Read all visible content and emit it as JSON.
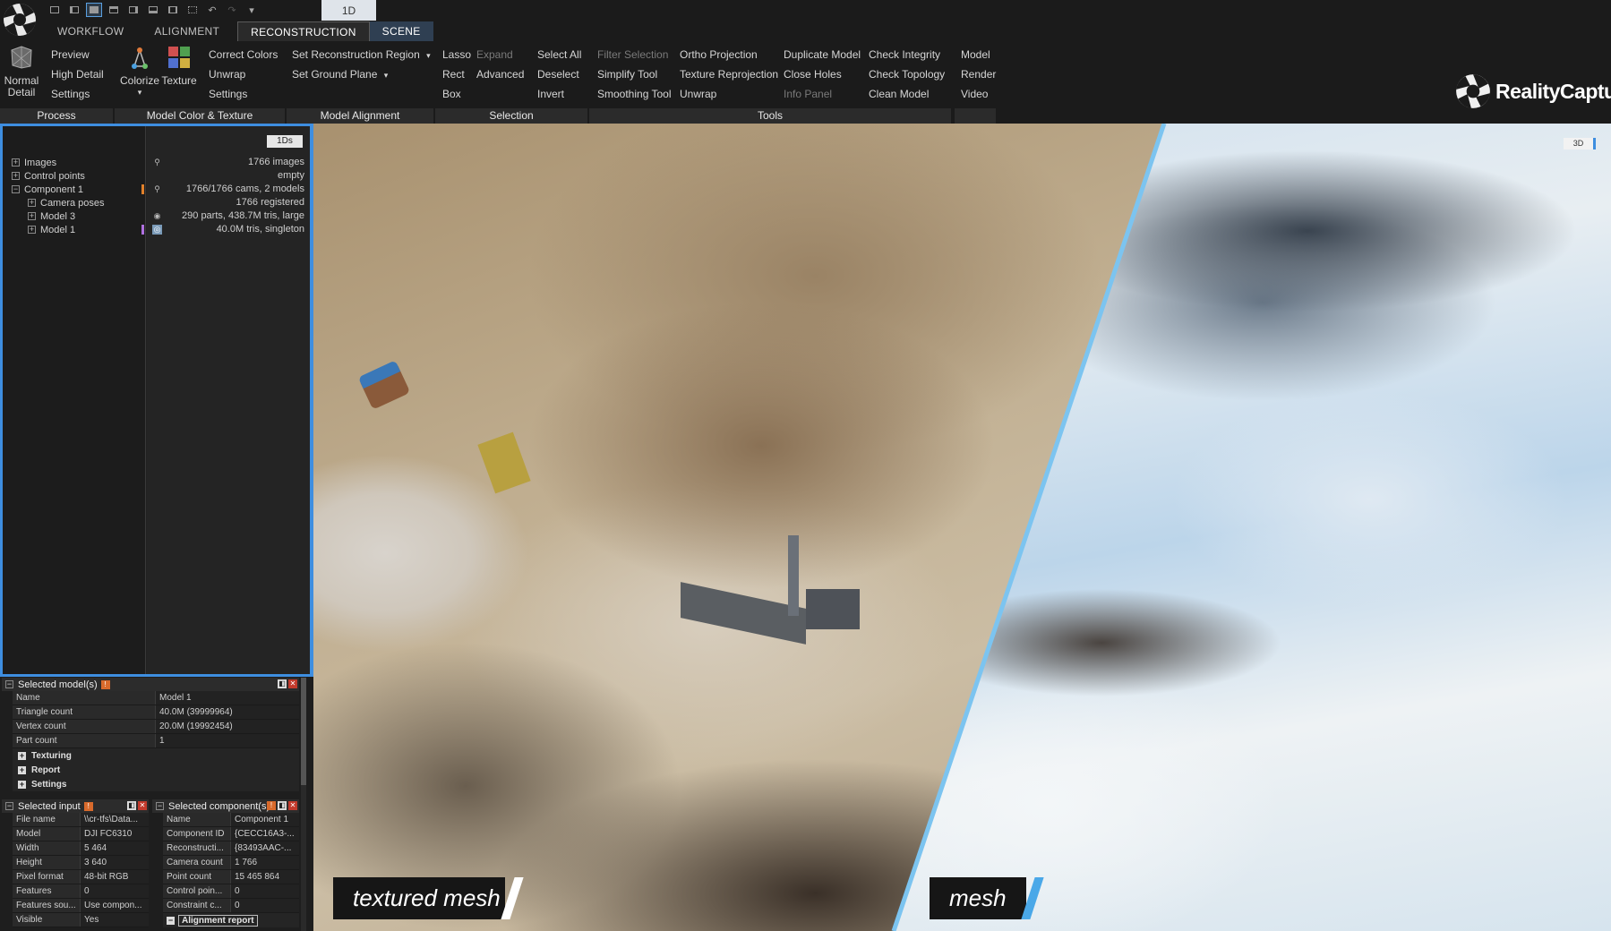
{
  "quick_toolbar": [
    "layout-1-icon",
    "layout-2-icon",
    "layout-3-icon",
    "layout-4-icon",
    "layout-5-icon",
    "layout-6-icon",
    "layout-7-icon",
    "layout-8-icon",
    "undo-icon",
    "redo-icon",
    "customize-icon"
  ],
  "tabs": [
    {
      "label": "WORKFLOW"
    },
    {
      "label": "ALIGNMENT"
    },
    {
      "label": "RECONSTRUCTION"
    },
    {
      "label": "SCENE"
    }
  ],
  "tab_1d": "1D",
  "ribbon": {
    "process": {
      "label": "Process",
      "normal_detail": "Normal\nDetail",
      "preview": "Preview",
      "high_detail": "High Detail",
      "settings": "Settings"
    },
    "model_color": {
      "label": "Model Color & Texture",
      "colorize": "Colorize",
      "texture": "Texture",
      "correct_colors": "Correct Colors",
      "unwrap": "Unwrap",
      "settings": "Settings"
    },
    "alignment": {
      "label": "Model Alignment",
      "set_region": "Set Reconstruction Region",
      "set_ground": "Set Ground Plane"
    },
    "selection": {
      "label": "Selection",
      "lasso": "Lasso",
      "expand": "Expand",
      "rect": "Rect",
      "advanced": "Advanced",
      "box": "Box",
      "select_all": "Select All",
      "deselect": "Deselect",
      "invert": "Invert"
    },
    "tools": {
      "label": "Tools",
      "filter_selection": "Filter Selection",
      "simplify_tool": "Simplify Tool",
      "smoothing_tool": "Smoothing Tool",
      "ortho_projection": "Ortho Projection",
      "texture_reprojection": "Texture Reprojection",
      "unwrap": "Unwrap",
      "duplicate_model": "Duplicate Model",
      "close_holes": "Close Holes",
      "info_panel": "Info Panel",
      "check_integrity": "Check Integrity",
      "check_topology": "Check Topology",
      "clean_model": "Clean Model"
    },
    "export": {
      "model": "Model",
      "render": "Render",
      "video": "Video"
    }
  },
  "brand": "RealityCapture",
  "tree": {
    "btn_1ds": "1Ds",
    "rows": [
      {
        "name": "Images",
        "value": "1766 images"
      },
      {
        "name": "Control points",
        "value": "empty"
      },
      {
        "name": "Component 1",
        "value": "1766/1766 cams, 2 models"
      },
      {
        "name": "Camera poses",
        "value": "1766 registered"
      },
      {
        "name": "Model 3",
        "value": "290 parts, 438.7M tris, large"
      },
      {
        "name": "Model 1",
        "value": "40.0M tris, singleton"
      }
    ]
  },
  "selected_models": {
    "title": "Selected model(s)",
    "rows": [
      {
        "k": "Name",
        "v": "Model 1"
      },
      {
        "k": "Triangle count",
        "v": "40.0M (39999964)"
      },
      {
        "k": "Vertex count",
        "v": "20.0M (19992454)"
      },
      {
        "k": "Part count",
        "v": "1"
      }
    ],
    "sections": [
      "Texturing",
      "Report",
      "Settings"
    ]
  },
  "selected_input": {
    "title": "Selected input",
    "rows": [
      {
        "k": "File name",
        "v": "\\\\cr-tfs\\Data..."
      },
      {
        "k": "Model",
        "v": "DJI FC6310"
      },
      {
        "k": "Width",
        "v": "5 464"
      },
      {
        "k": "Height",
        "v": "3 640"
      },
      {
        "k": "Pixel format",
        "v": "48-bit RGB"
      },
      {
        "k": "Features",
        "v": "0"
      },
      {
        "k": "Features sou...",
        "v": "Use compon..."
      },
      {
        "k": "Visible",
        "v": "Yes"
      }
    ]
  },
  "selected_component": {
    "title": "Selected component(s)",
    "rows": [
      {
        "k": "Name",
        "v": "Component 1"
      },
      {
        "k": "Component ID",
        "v": "{CECC16A3-..."
      },
      {
        "k": "Reconstructi...",
        "v": "{83493AAC-..."
      },
      {
        "k": "Camera count",
        "v": "1 766"
      },
      {
        "k": "Point count",
        "v": "15 465 864"
      },
      {
        "k": "Control poin...",
        "v": "0"
      },
      {
        "k": "Constraint c...",
        "v": "0"
      }
    ],
    "alignment_report": "Alignment report"
  },
  "viewport": {
    "btn_3d": "3D",
    "caption_left": "textured mesh",
    "caption_right": "mesh"
  }
}
